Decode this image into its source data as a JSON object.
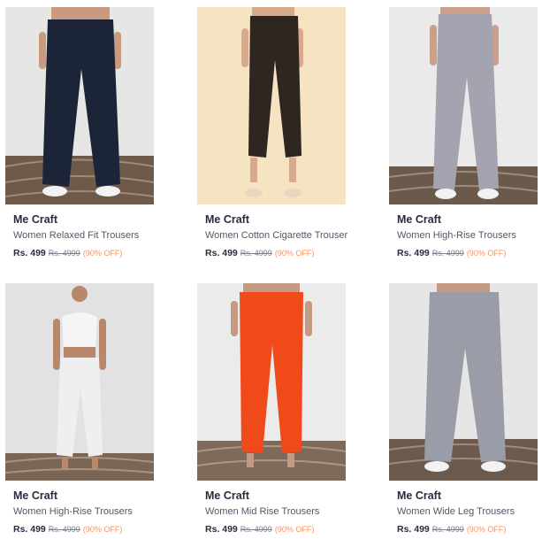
{
  "products": [
    {
      "brand": "Me Craft",
      "name": "Women Relaxed Fit Trousers",
      "price": "Rs. 499",
      "mrp": "Rs. 4999",
      "discount": "(90% OFF)",
      "pant_color": "#1c2438",
      "bg_color": "#e6e6e4"
    },
    {
      "brand": "Me Craft",
      "name": "Women Cotton Cigarette Trouser",
      "price": "Rs. 499",
      "mrp": "Rs. 4999",
      "discount": "(90% OFF)",
      "pant_color": "#2e2620",
      "bg_color": "#f6e3c2"
    },
    {
      "brand": "Me Craft",
      "name": "Women High-Rise Trousers",
      "price": "Rs. 499",
      "mrp": "Rs. 4999",
      "discount": "(90% OFF)",
      "pant_color": "#a3a4b0",
      "bg_color": "#eaeaea"
    },
    {
      "brand": "Me Craft",
      "name": "Women High-Rise Trousers",
      "price": "Rs. 499",
      "mrp": "Rs. 4999",
      "discount": "(90% OFF)",
      "pant_color": "#efefef",
      "bg_color": "#e2e2e2"
    },
    {
      "brand": "Me Craft",
      "name": "Women Mid Rise Trousers",
      "price": "Rs. 499",
      "mrp": "Rs. 4999",
      "discount": "(90% OFF)",
      "pant_color": "#f04a1a",
      "bg_color": "#ebebeb"
    },
    {
      "brand": "Me Craft",
      "name": "Women Wide Leg Trousers",
      "price": "Rs. 499",
      "mrp": "Rs. 4999",
      "discount": "(90% OFF)",
      "pant_color": "#9a9ca7",
      "bg_color": "#e6e6e6"
    }
  ]
}
